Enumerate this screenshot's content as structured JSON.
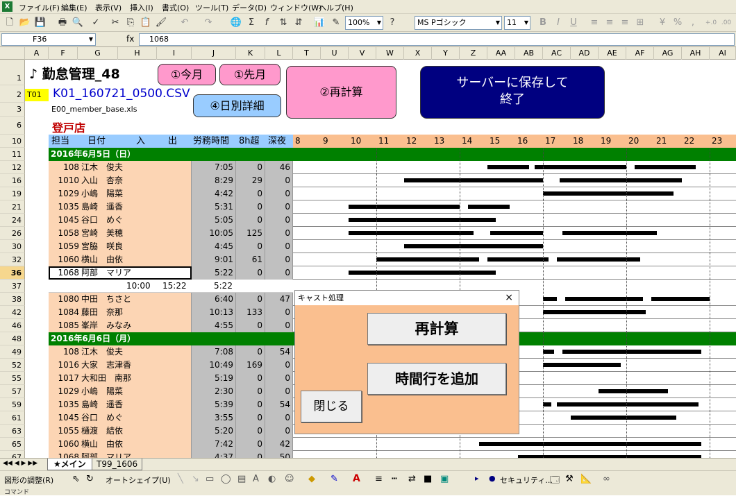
{
  "menu": [
    "ファイル(F)",
    "編集(E)",
    "表示(V)",
    "挿入(I)",
    "書式(O)",
    "ツール(T)",
    "データ(D)",
    "ウィンドウ(W)",
    "ヘルプ(H)"
  ],
  "toolbar": {
    "zoom": "100%",
    "font": "MS Pゴシック",
    "size": "11"
  },
  "formula": {
    "cell": "F36",
    "fx": "fx",
    "value": "1068"
  },
  "columns": [
    "A",
    "F",
    "G",
    "H",
    "I",
    "J",
    "K",
    "L",
    "T",
    "U",
    "V",
    "W",
    "X",
    "Y",
    "Z",
    "AA",
    "AB",
    "AC",
    "AD",
    "AE",
    "AF",
    "AG",
    "AH",
    "AI"
  ],
  "header": {
    "title": "♪ 勤怠管理_48",
    "tag": "T01",
    "file": "K01_160721_0500.CSV",
    "base": "E00_member_base.xls",
    "store": "登戸店"
  },
  "buttons": {
    "this_month": "①今月",
    "last_month": "①先月",
    "recalc": "②再計算",
    "daily": "④日別詳細",
    "save_exit_1": "サーバーに保存して",
    "save_exit_2": "終了"
  },
  "table_header": {
    "c1": "担当",
    "c2": "日付",
    "c3": "入",
    "c4": "出",
    "c5": "労務時間",
    "c6": "8h超",
    "c7": "深夜",
    "hours": [
      "8",
      "9",
      "10",
      "11",
      "12",
      "13",
      "14",
      "15",
      "16",
      "17",
      "18",
      "19",
      "20",
      "21",
      "22",
      "23"
    ]
  },
  "rows": [
    {
      "rn": "10",
      "type": "hdr"
    },
    {
      "rn": "11",
      "type": "date",
      "text": "2016年6月5日（日）"
    },
    {
      "rn": "12",
      "id": "108",
      "name": "江木　俊夫",
      "work": "7:05",
      "over": "0",
      "night": "46"
    },
    {
      "rn": "16",
      "id": "1010",
      "name": "入山　杏奈",
      "work": "8:29",
      "over": "29",
      "night": "0"
    },
    {
      "rn": "19",
      "id": "1029",
      "name": "小嶋　陽菜",
      "work": "4:42",
      "over": "0",
      "night": "0"
    },
    {
      "rn": "21",
      "id": "1035",
      "name": "島崎　遥香",
      "work": "5:31",
      "over": "0",
      "night": "0"
    },
    {
      "rn": "24",
      "id": "1045",
      "name": "谷口　めぐ",
      "work": "5:05",
      "over": "0",
      "night": "0"
    },
    {
      "rn": "26",
      "id": "1058",
      "name": "宮崎　美穂",
      "work": "10:05",
      "over": "125",
      "night": "0"
    },
    {
      "rn": "30",
      "id": "1059",
      "name": "宮脇　咲良",
      "work": "4:45",
      "over": "0",
      "night": "0"
    },
    {
      "rn": "32",
      "id": "1060",
      "name": "横山　由依",
      "work": "9:01",
      "over": "61",
      "night": "0"
    },
    {
      "rn": "36",
      "id": "1068",
      "name": "阿部　マリア",
      "work": "5:22",
      "over": "0",
      "night": "0"
    },
    {
      "rn": "37",
      "type": "time",
      "in": "10:00",
      "out": "15:22",
      "work": "5:22"
    },
    {
      "rn": "38",
      "id": "1080",
      "name": "中田　ちさと",
      "work": "6:40",
      "over": "0",
      "night": "47"
    },
    {
      "rn": "42",
      "id": "1084",
      "name": "藤田　奈那",
      "work": "10:13",
      "over": "133",
      "night": "0"
    },
    {
      "rn": "46",
      "id": "1085",
      "name": "峯岸　みなみ",
      "work": "4:55",
      "over": "0",
      "night": "0"
    },
    {
      "rn": "48",
      "type": "date",
      "text": "2016年6月6日（月）"
    },
    {
      "rn": "49",
      "id": "108",
      "name": "江木　俊夫",
      "work": "7:08",
      "over": "0",
      "night": "54"
    },
    {
      "rn": "52",
      "id": "1016",
      "name": "大家　志津香",
      "work": "10:49",
      "over": "169",
      "night": "0"
    },
    {
      "rn": "55",
      "id": "1017",
      "name": "大和田　南那",
      "work": "5:19",
      "over": "0",
      "night": "0"
    },
    {
      "rn": "57",
      "id": "1029",
      "name": "小嶋　陽菜",
      "work": "2:30",
      "over": "0",
      "night": "0"
    },
    {
      "rn": "59",
      "id": "1035",
      "name": "島崎　遥香",
      "work": "5:39",
      "over": "0",
      "night": "54"
    },
    {
      "rn": "61",
      "id": "1045",
      "name": "谷口　めぐ",
      "work": "3:55",
      "over": "0",
      "night": "0"
    },
    {
      "rn": "63",
      "id": "1055",
      "name": "樋渡　結依",
      "work": "5:20",
      "over": "0",
      "night": "0"
    },
    {
      "rn": "65",
      "id": "1060",
      "name": "横山　由依",
      "work": "7:42",
      "over": "0",
      "night": "42"
    },
    {
      "rn": "67",
      "id": "1068",
      "name": "阿部　マリア",
      "work": "4:37",
      "over": "0",
      "night": "50"
    }
  ],
  "first_row_labels": [
    "1",
    "2",
    "3",
    "6"
  ],
  "sheets": [
    "★メイン",
    "T99_1606"
  ],
  "drawbar": {
    "adjust": "図形の調整(R)",
    "autoshape": "オートシェイプ(U)",
    "security": "セキュリティ..."
  },
  "status": "コマンド",
  "dialog": {
    "title": "キャスト処理",
    "close": "×",
    "recalc": "再計算",
    "add_row": "時間行を追加",
    "close_btn": "閉じる"
  }
}
